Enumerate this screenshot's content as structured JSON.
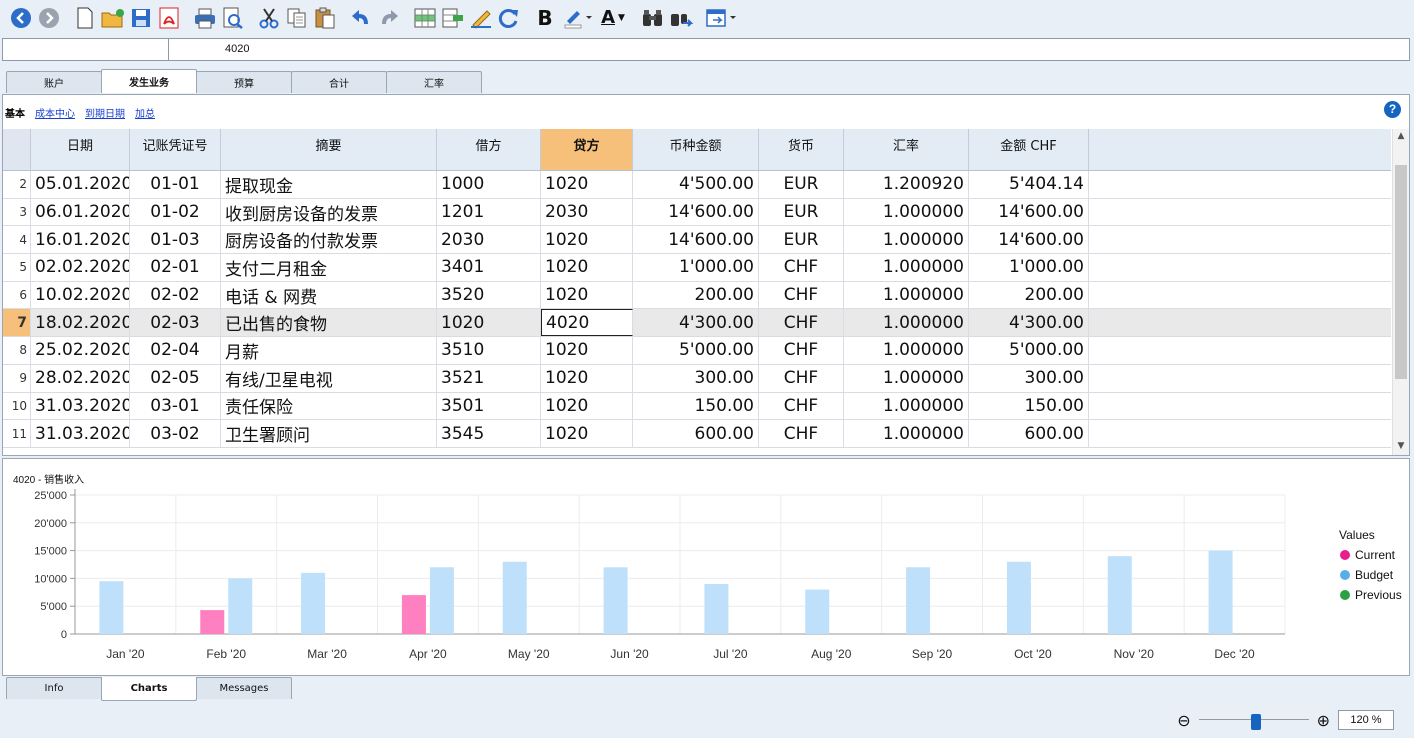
{
  "toolbar": {
    "icons": [
      "back-icon",
      "forward-icon",
      "new-file-icon",
      "open-file-icon",
      "save-icon",
      "pdf-icon",
      "print-icon",
      "print-preview-icon",
      "cut-icon",
      "copy-icon",
      "paste-icon",
      "undo-icon",
      "redo-icon",
      "insert-row-icon",
      "column-icon",
      "edit-icon",
      "recheck-icon",
      "bold-icon",
      "highlight-icon",
      "font-color-icon",
      "find-icon",
      "find-next-icon",
      "window-icon"
    ],
    "bold_label": "B",
    "font_color_label": "A"
  },
  "cellbar": {
    "value": "4020"
  },
  "table_tabs": [
    "账户",
    "发生业务",
    "预算",
    "合计",
    "汇率"
  ],
  "active_table_tab": "发生业务",
  "views": [
    "基本",
    "成本中心",
    "到期日期",
    "加总"
  ],
  "active_view": "基本",
  "help_label": "?",
  "grid": {
    "headers": [
      "日期",
      "记账凭证号",
      "摘要",
      "借方",
      "贷方",
      "币种金额",
      "货币",
      "汇率",
      "金额 CHF"
    ],
    "rows": [
      {
        "n": "2",
        "date": "05.01.2020",
        "doc": "01-01",
        "desc": "提取现金",
        "debit": "1000",
        "credit": "1020",
        "amt": "4'500.00",
        "cur": "EUR",
        "rate": "1.200920",
        "chf": "5'404.14"
      },
      {
        "n": "3",
        "date": "06.01.2020",
        "doc": "01-02",
        "desc": "收到厨房设备的发票",
        "debit": "1201",
        "credit": "2030",
        "amt": "14'600.00",
        "cur": "EUR",
        "rate": "1.000000",
        "chf": "14'600.00"
      },
      {
        "n": "4",
        "date": "16.01.2020",
        "doc": "01-03",
        "desc": "厨房设备的付款发票",
        "debit": "2030",
        "credit": "1020",
        "amt": "14'600.00",
        "cur": "EUR",
        "rate": "1.000000",
        "chf": "14'600.00"
      },
      {
        "n": "5",
        "date": "02.02.2020",
        "doc": "02-01",
        "desc": "支付二月租金",
        "debit": "3401",
        "credit": "1020",
        "amt": "1'000.00",
        "cur": "CHF",
        "rate": "1.000000",
        "chf": "1'000.00"
      },
      {
        "n": "6",
        "date": "10.02.2020",
        "doc": "02-02",
        "desc": "电话 & 网费",
        "debit": "3520",
        "credit": "1020",
        "amt": "200.00",
        "cur": "CHF",
        "rate": "1.000000",
        "chf": "200.00"
      },
      {
        "n": "7",
        "date": "18.02.2020",
        "doc": "02-03",
        "desc": "已出售的食物",
        "debit": "1020",
        "credit": "4020",
        "amt": "4'300.00",
        "cur": "CHF",
        "rate": "1.000000",
        "chf": "4'300.00"
      },
      {
        "n": "8",
        "date": "25.02.2020",
        "doc": "02-04",
        "desc": "月薪",
        "debit": "3510",
        "credit": "1020",
        "amt": "5'000.00",
        "cur": "CHF",
        "rate": "1.000000",
        "chf": "5'000.00"
      },
      {
        "n": "9",
        "date": "28.02.2020",
        "doc": "02-05",
        "desc": "有线/卫星电视",
        "debit": "3521",
        "credit": "1020",
        "amt": "300.00",
        "cur": "CHF",
        "rate": "1.000000",
        "chf": "300.00"
      },
      {
        "n": "10",
        "date": "31.03.2020",
        "doc": "03-01",
        "desc": "责任保险",
        "debit": "3501",
        "credit": "1020",
        "amt": "150.00",
        "cur": "CHF",
        "rate": "1.000000",
        "chf": "150.00"
      },
      {
        "n": "11",
        "date": "31.03.2020",
        "doc": "03-02",
        "desc": "卫生署顾问",
        "debit": "3545",
        "credit": "1020",
        "amt": "600.00",
        "cur": "CHF",
        "rate": "1.000000",
        "chf": "600.00"
      }
    ],
    "selected_row": "7",
    "highlight_column": "贷方"
  },
  "chart_data": {
    "type": "bar",
    "title": "4020 - 销售收入",
    "categories": [
      "Jan '20",
      "Feb '20",
      "Mar '20",
      "Apr '20",
      "May '20",
      "Jun '20",
      "Jul '20",
      "Aug '20",
      "Sep '20",
      "Oct '20",
      "Nov '20",
      "Dec '20"
    ],
    "series": [
      {
        "name": "Current",
        "color": "#ff80c0",
        "values": [
          0,
          4300,
          0,
          7000,
          0,
          0,
          0,
          0,
          0,
          0,
          0,
          0
        ]
      },
      {
        "name": "Budget",
        "color": "#bfe0fa",
        "values": [
          9500,
          10000,
          11000,
          12000,
          13000,
          12000,
          9000,
          8000,
          12000,
          13000,
          14000,
          15000
        ]
      },
      {
        "name": "Previous",
        "color": "#2ea043",
        "values": [
          0,
          0,
          0,
          0,
          0,
          0,
          0,
          0,
          0,
          0,
          0,
          0
        ]
      }
    ],
    "ylim": [
      0,
      25000
    ],
    "yticks": [
      "25'000",
      "20'000",
      "15'000",
      "10'000",
      "5'000",
      "0"
    ],
    "legend_title": "Values",
    "legend_position": "right",
    "legend_colors": {
      "Current": "#e91e8c",
      "Budget": "#5aaee8",
      "Previous": "#2ea043"
    },
    "grid": true
  },
  "bottom_tabs": [
    "Info",
    "Charts",
    "Messages"
  ],
  "active_bottom_tab": "Charts",
  "zoom": {
    "value": "120 %",
    "level_percent": 120,
    "zoom_out_icon": "zoom-out-icon",
    "zoom_in_icon": "zoom-in-icon"
  }
}
